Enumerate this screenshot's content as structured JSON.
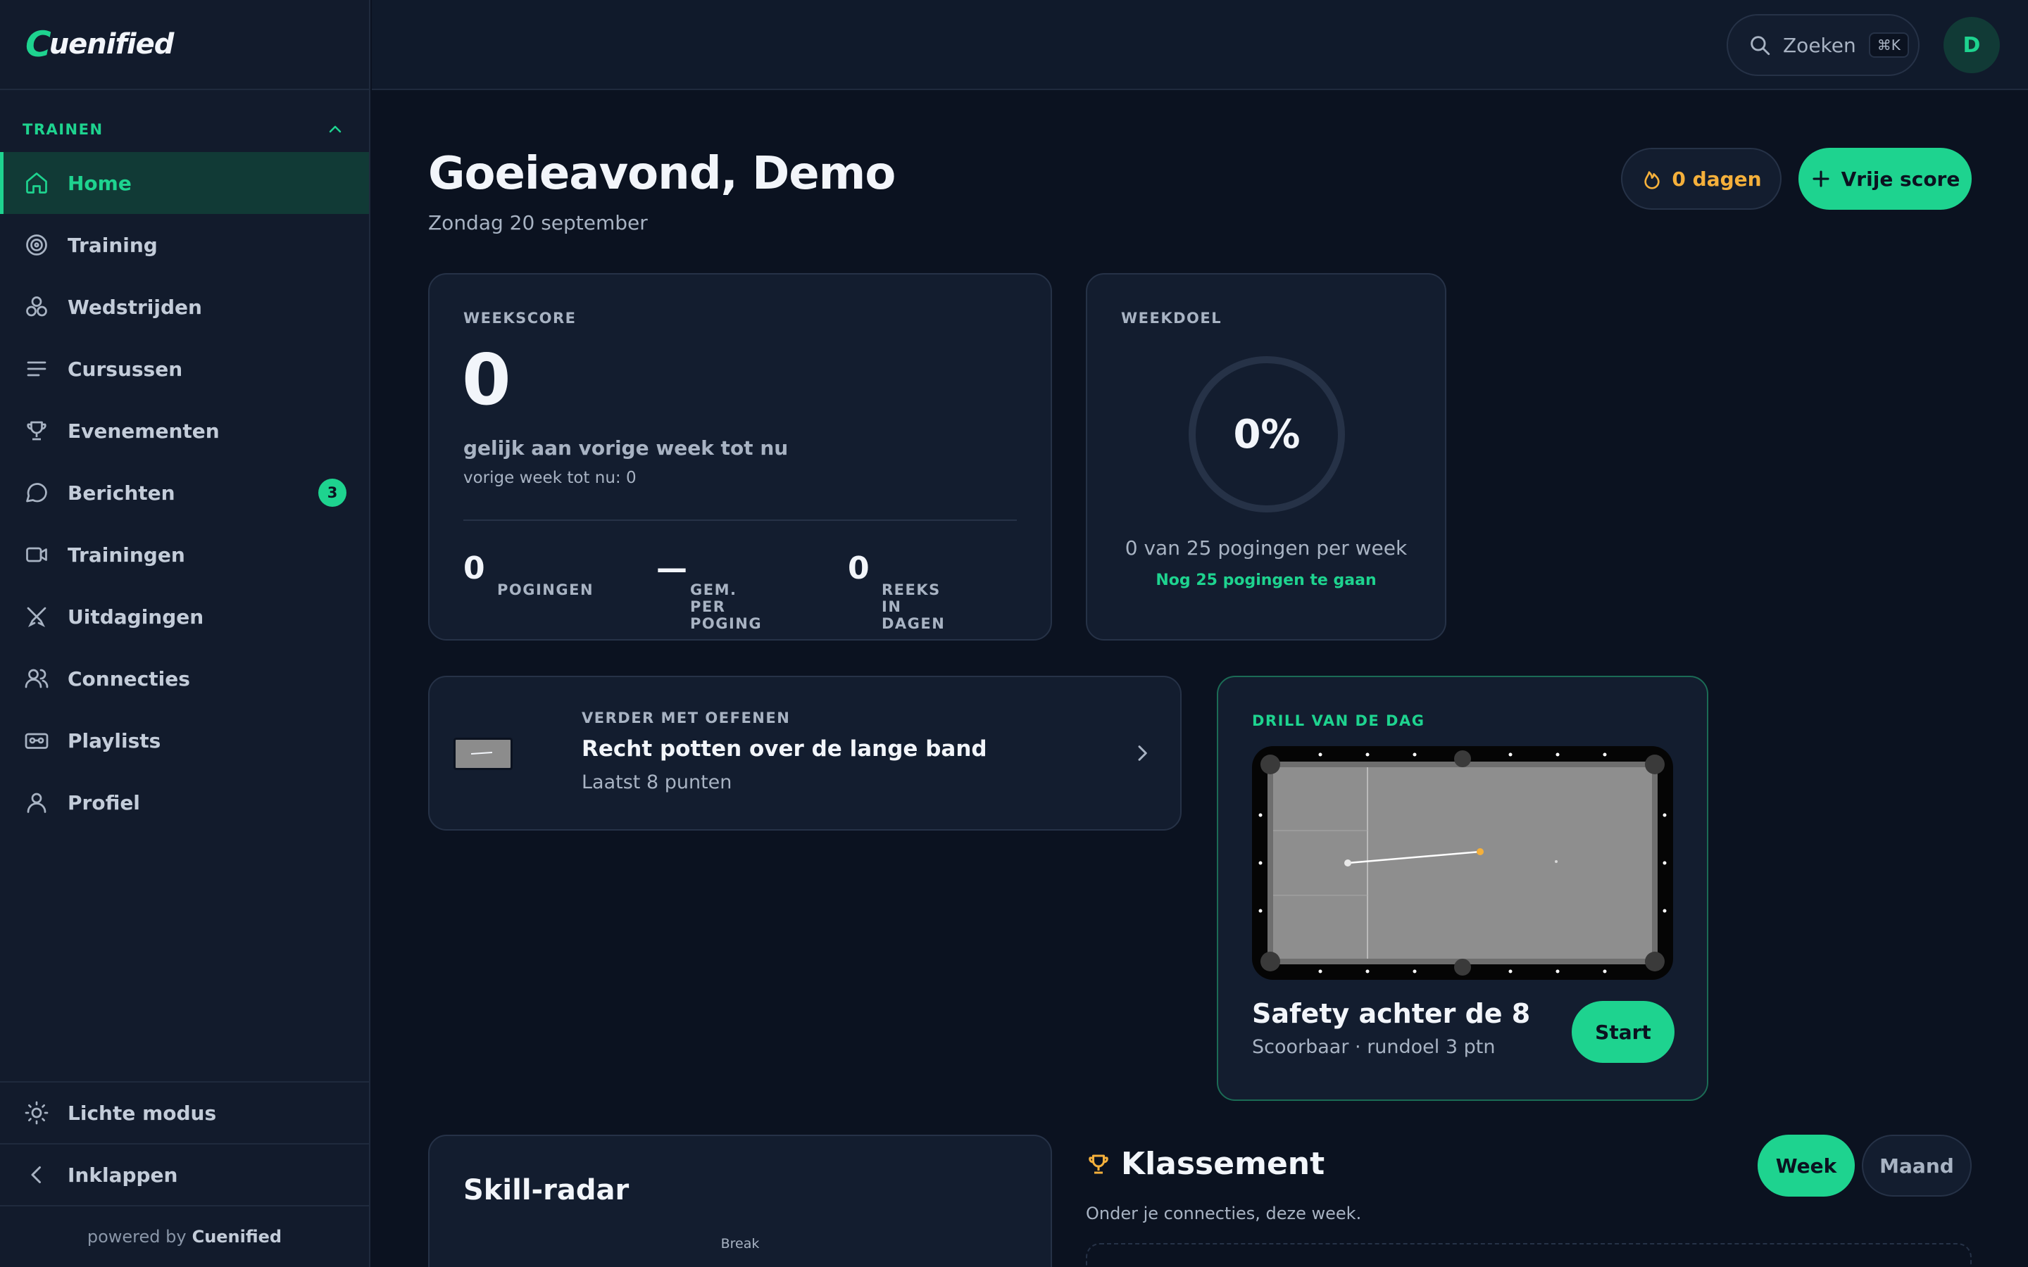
{
  "app": {
    "logo_initial": "C",
    "logo_text": "uenified"
  },
  "sidebar": {
    "section_label": "TRAINEN",
    "items": [
      {
        "label": "Home"
      },
      {
        "label": "Training"
      },
      {
        "label": "Wedstrijden"
      },
      {
        "label": "Cursussen"
      },
      {
        "label": "Evenementen"
      },
      {
        "label": "Berichten",
        "badge": "3"
      },
      {
        "label": "Trainingen"
      },
      {
        "label": "Uitdagingen"
      },
      {
        "label": "Connecties"
      },
      {
        "label": "Playlists"
      },
      {
        "label": "Profiel"
      }
    ],
    "light_mode": "Lichte modus",
    "collapse": "Inklappen",
    "powered_prefix": "powered by",
    "powered_brand": "Cuenified"
  },
  "topbar": {
    "search_label": "Zoeken",
    "search_shortcut": "⌘K",
    "avatar_initial": "D"
  },
  "header": {
    "greeting": "Goeieavond, Demo",
    "date": "Zondag 20 september",
    "streak": "0 dagen",
    "free_score": "Vrije score"
  },
  "weekscore": {
    "label": "WEEKSCORE",
    "value": "0",
    "compare": "gelijk aan vorige week tot nu",
    "previous": "vorige week tot nu: 0",
    "stats": [
      {
        "label": "POGINGEN",
        "value": "0"
      },
      {
        "label": "GEM. PER POGING",
        "value": "—"
      },
      {
        "label": "REEKS IN DAGEN",
        "value": "0"
      }
    ]
  },
  "weekgoal": {
    "label": "WEEKDOEL",
    "percent": "0%",
    "progress": 0,
    "summary": "0 van 25 pogingen per week",
    "remaining": "Nog 25 pogingen te gaan"
  },
  "continue": {
    "label": "VERDER MET OEFENEN",
    "title": "Recht potten over de lange band",
    "subtitle": "Laatst 8 punten"
  },
  "drill": {
    "label": "DRILL VAN DE DAG",
    "title": "Safety achter de 8",
    "subtitle": "Scoorbaar · rundoel 3 ptn",
    "start": "Start"
  },
  "radar": {
    "title": "Skill-radar",
    "axis_top": "Break"
  },
  "ranking": {
    "title": "Klassement",
    "subtitle": "Onder je connecties, deze week.",
    "tab_week": "Week",
    "tab_month": "Maand"
  },
  "colors": {
    "accent": "#1ed38f",
    "streak": "#f5b03b",
    "background": "#0b1220",
    "card": "#131d2f"
  }
}
